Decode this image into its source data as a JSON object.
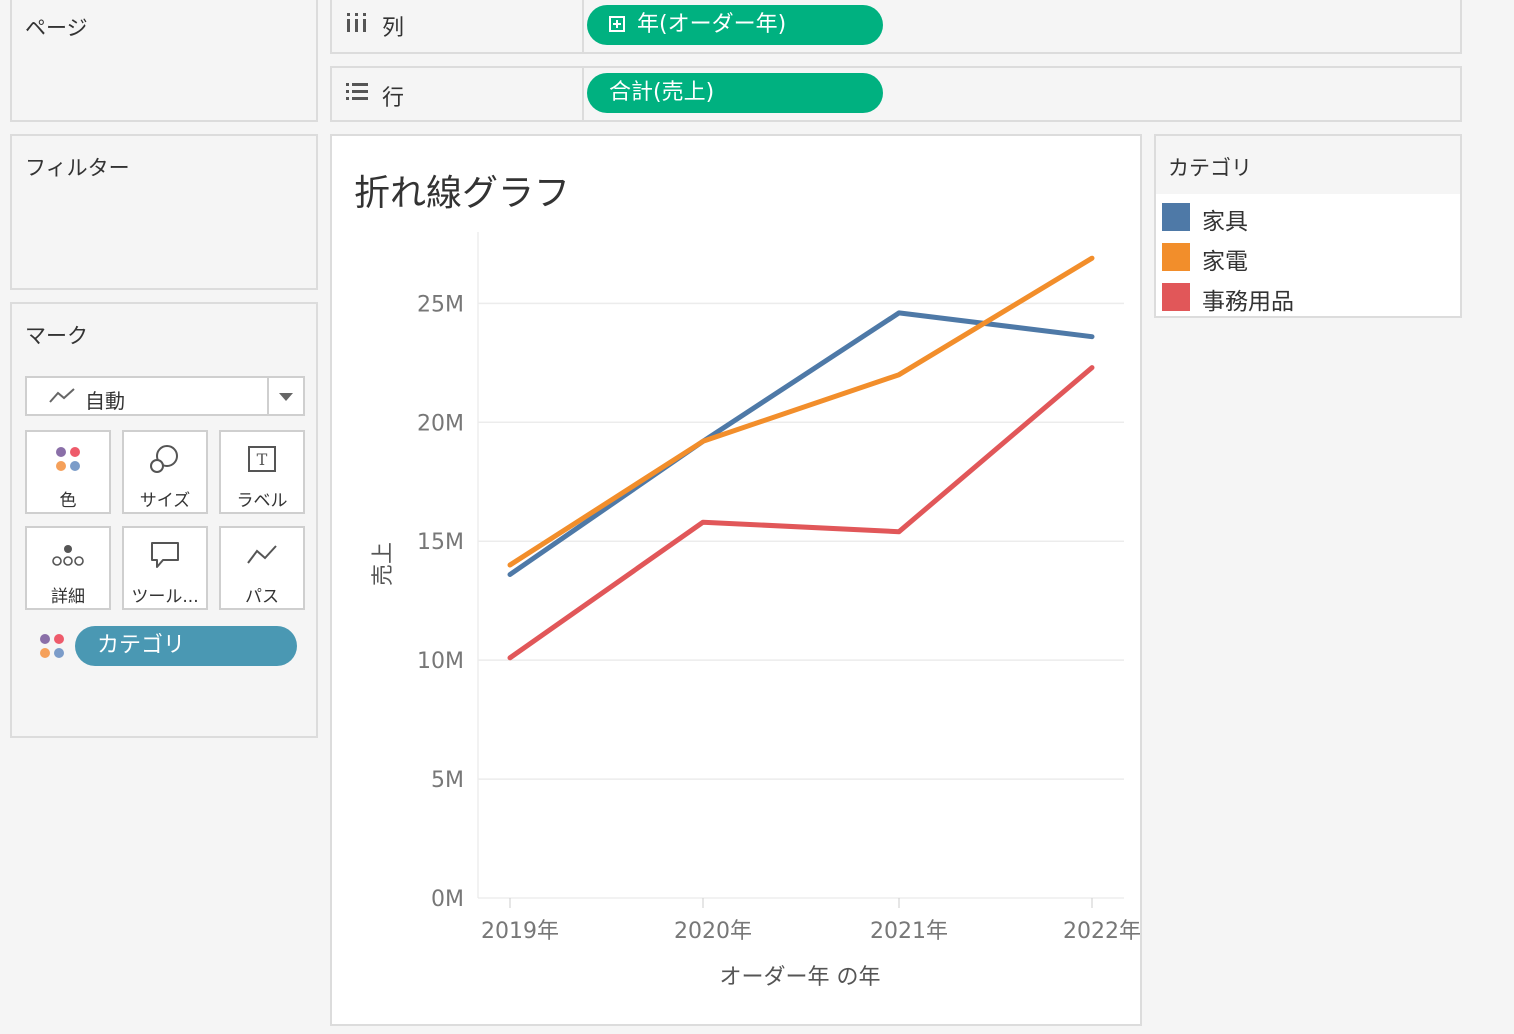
{
  "panels": {
    "pages_title": "ページ",
    "filters_title": "フィルター",
    "marks_title": "マーク"
  },
  "shelves": {
    "columns": {
      "label": "列",
      "pill": "年(オーダー年)"
    },
    "rows": {
      "label": "行",
      "pill": "合計(売上)"
    }
  },
  "marks": {
    "type": "自動",
    "buttons": {
      "color": "色",
      "size": "サイズ",
      "label": "ラベル",
      "detail": "詳細",
      "tooltip": "ツール...",
      "path": "パス"
    },
    "color_pill": "カテゴリ"
  },
  "legend": {
    "title": "カテゴリ",
    "items": [
      {
        "label": "家具",
        "color": "#4e79a7"
      },
      {
        "label": "家電",
        "color": "#f28e2b"
      },
      {
        "label": "事務用品",
        "color": "#e15759"
      }
    ]
  },
  "chart_data": {
    "type": "line",
    "title": "折れ線グラフ",
    "xlabel": "オーダー年 の年",
    "ylabel": "売上",
    "categories": [
      "2019年",
      "2020年",
      "2021年",
      "2022年"
    ],
    "y_ticks": [
      "0M",
      "5M",
      "10M",
      "15M",
      "20M",
      "25M"
    ],
    "ylim": [
      0,
      28
    ],
    "grid": true,
    "series": [
      {
        "name": "家具",
        "color": "#4e79a7",
        "values": [
          13.6,
          19.2,
          24.6,
          23.6
        ]
      },
      {
        "name": "家電",
        "color": "#f28e2b",
        "values": [
          14.0,
          19.2,
          22.0,
          26.9
        ]
      },
      {
        "name": "事務用品",
        "color": "#e15759",
        "values": [
          10.1,
          15.8,
          15.4,
          22.3
        ]
      }
    ]
  }
}
